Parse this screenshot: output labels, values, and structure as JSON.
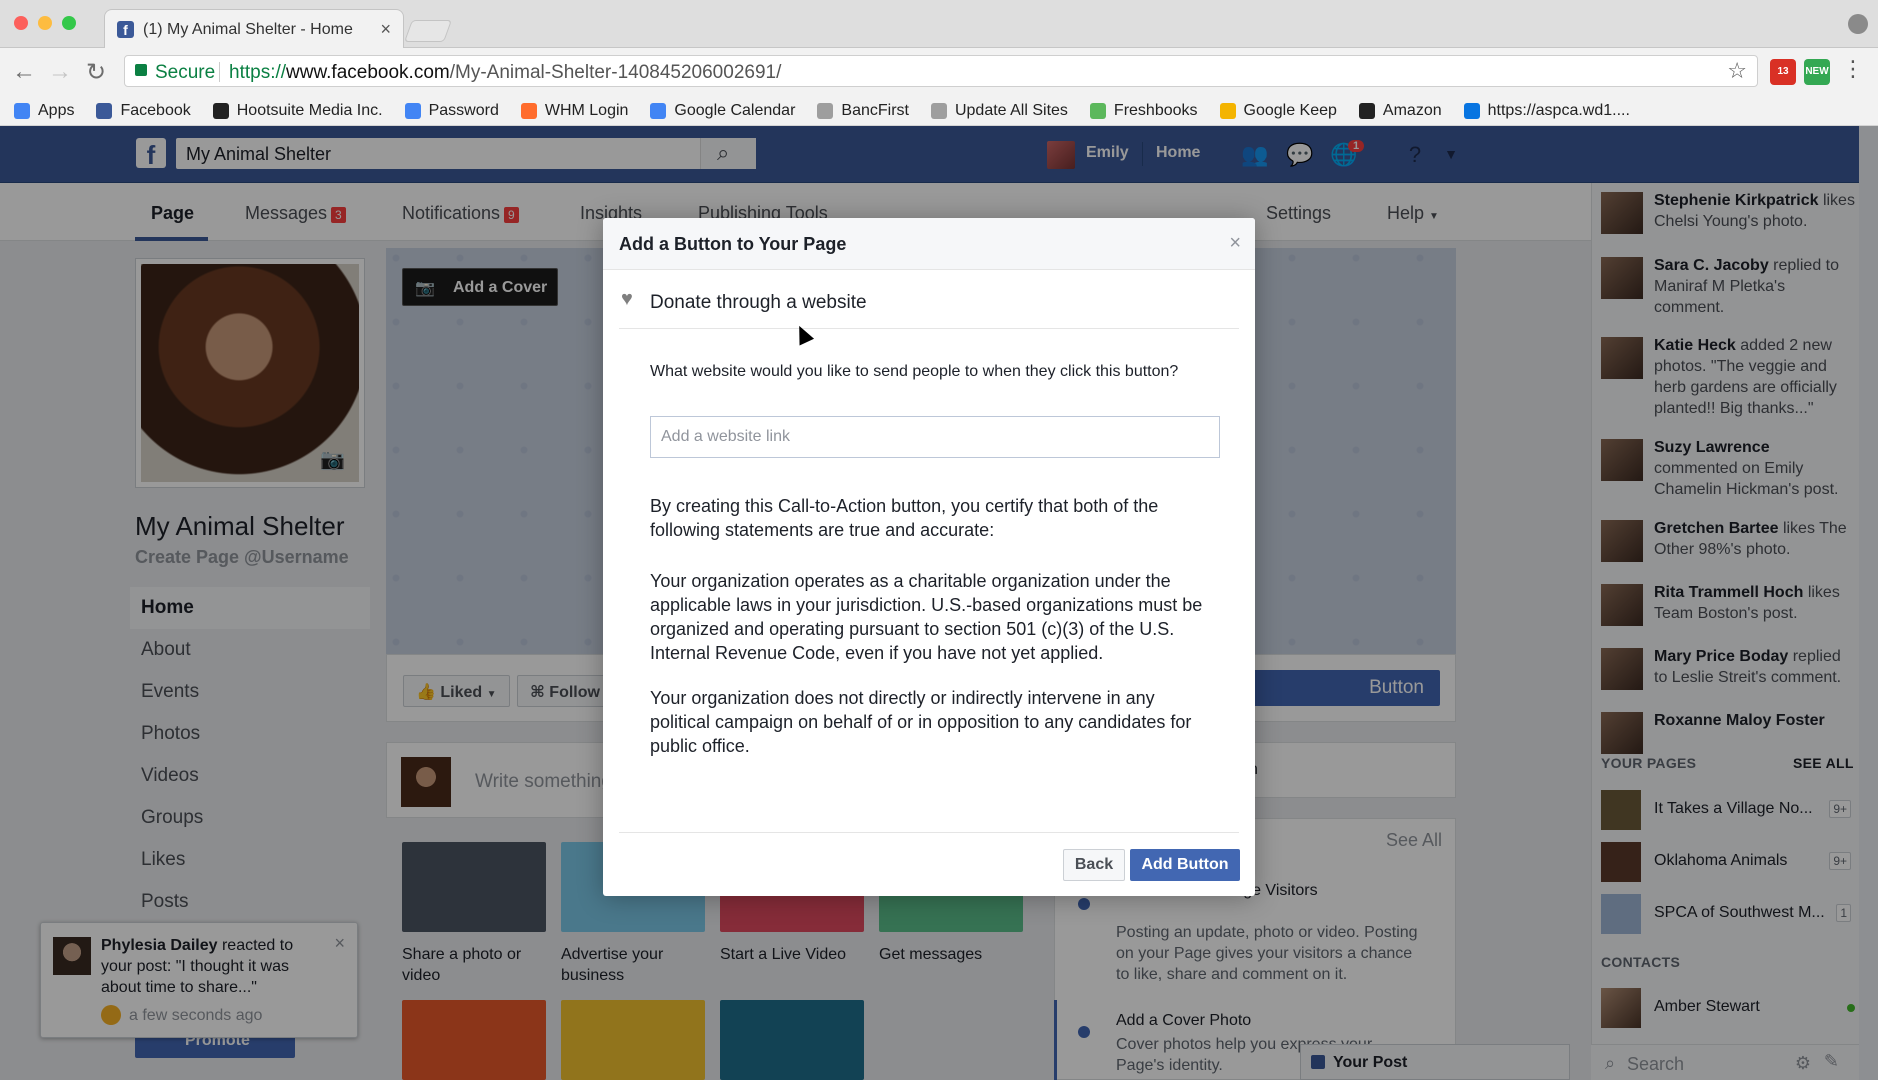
{
  "browser": {
    "tab_title": "(1) My Animal Shelter - Home",
    "secure_label": "Secure",
    "url_scheme": "https://",
    "url_host": "www.facebook.com",
    "url_path": "/My-Animal-Shelter-140845206002691/",
    "extensions": [
      {
        "label": "13",
        "color": "#d93025"
      },
      {
        "label": "NEW",
        "color": "#34a853"
      }
    ],
    "bookmarks": [
      {
        "label": "Apps",
        "icon": "apps-grid-icon",
        "color": "#4285f4"
      },
      {
        "label": "Facebook",
        "icon": "facebook-icon",
        "color": "#3b5998"
      },
      {
        "label": "Hootsuite Media Inc.",
        "icon": "hootsuite-icon",
        "color": "#222222"
      },
      {
        "label": "Password",
        "icon": "google-icon",
        "color": "#4285f4"
      },
      {
        "label": "WHM Login",
        "icon": "cpanel-icon",
        "color": "#ff6c2c"
      },
      {
        "label": "Google Calendar",
        "icon": "google-icon",
        "color": "#4285f4"
      },
      {
        "label": "BancFirst",
        "icon": "page-icon",
        "color": "#9e9e9e"
      },
      {
        "label": "Update All Sites",
        "icon": "page-icon",
        "color": "#9e9e9e"
      },
      {
        "label": "Freshbooks",
        "icon": "leaf-icon",
        "color": "#5cb85c"
      },
      {
        "label": "Google Keep",
        "icon": "keep-icon",
        "color": "#f4b400"
      },
      {
        "label": "Amazon",
        "icon": "amazon-icon",
        "color": "#222222"
      },
      {
        "label": "https://aspca.wd1....",
        "icon": "workday-icon",
        "color": "#0875e1"
      }
    ]
  },
  "fb": {
    "search_value": "My Animal Shelter",
    "user_name": "Emily",
    "home_label": "Home",
    "notif_count": "1"
  },
  "page_tabs": [
    {
      "label": "Page",
      "badge": ""
    },
    {
      "label": "Messages",
      "badge": "3"
    },
    {
      "label": "Notifications",
      "badge": "9"
    },
    {
      "label": "Insights",
      "badge": ""
    },
    {
      "label": "Publishing Tools",
      "badge": ""
    },
    {
      "label": "Settings",
      "badge": ""
    },
    {
      "label": "Help",
      "badge": ""
    }
  ],
  "page": {
    "name": "My Animal Shelter",
    "username_link": "Create Page @Username",
    "nav": [
      "Home",
      "About",
      "Events",
      "Photos",
      "Videos",
      "Groups",
      "Likes",
      "Posts"
    ],
    "add_cover": "Add a Cover",
    "liked": "Liked",
    "follow": "Follow",
    "cta_button": "Button",
    "composer_placeholder": "Write something",
    "tiles": [
      {
        "label": "Share a photo or video",
        "color": "#4b5563"
      },
      {
        "label": "Advertise your business",
        "color": "#7cc8e8"
      },
      {
        "label": "Start a Live Video",
        "color": "#e04a5f"
      },
      {
        "label": "Get messages",
        "color": "#5bbf8a"
      }
    ],
    "tiles_row2": [
      {
        "color": "#e8592a"
      },
      {
        "color": "#f2c230"
      },
      {
        "color": "#1e6f8c"
      }
    ],
    "card_suffix": "n",
    "see_all": "See All",
    "tip1_title": "nect With Your Page Visitors",
    "tip1_body": "Posting an update, photo or video. Posting on your Page gives your visitors a chance to like, share and comment on it.",
    "tip2_title": "Add a Cover Photo",
    "tip2_body": "Cover photos help you express your Page's identity.",
    "your_post": "Your Post",
    "promote": "Promote"
  },
  "toast": {
    "actor": "Phylesia Dailey",
    "text": " reacted to your post: \"I thought it was about time to share...\"",
    "time": "a few seconds ago"
  },
  "ticker": {
    "items": [
      {
        "actor": "Stephenie Kirkpatrick",
        "text": " likes Chelsi Young's photo."
      },
      {
        "actor": "Sara C. Jacoby",
        "text": " replied to Maniraf M Pletka's comment."
      },
      {
        "actor": "Katie Heck",
        "text": " added 2 new photos. \"The veggie and herb gardens are officially planted!! Big thanks...\""
      },
      {
        "actor": "Suzy Lawrence",
        "text": " commented on Emily Chamelin Hickman's post."
      },
      {
        "actor": "Gretchen Bartee",
        "text": " likes The Other 98%'s photo."
      },
      {
        "actor": "Rita Trammell Hoch",
        "text": " likes Team Boston's post."
      },
      {
        "actor": "Mary Price Boday",
        "text": " replied to Leslie Streit's comment."
      },
      {
        "actor": "Roxanne Maloy Foster",
        "text": ""
      }
    ],
    "your_pages_heading": "YOUR PAGES",
    "see_all": "SEE ALL",
    "pages": [
      {
        "name": "It Takes a Village No...",
        "count": "9+"
      },
      {
        "name": "Oklahoma Animals",
        "count": "9+"
      },
      {
        "name": "SPCA of Southwest M...",
        "count": "1"
      }
    ],
    "contacts_heading": "CONTACTS",
    "contacts": [
      {
        "name": "Amber Stewart",
        "status_color": "#42b72a"
      }
    ],
    "search_placeholder": "Search"
  },
  "modal": {
    "title": "Add a Button to Your Page",
    "option": "Donate through a website",
    "question": "What website would you like to send people to when they click this button?",
    "input_placeholder": "Add a website link",
    "para1": "By creating this Call-to-Action button, you certify that both of the following statements are true and accurate:",
    "para2": "Your organization operates as a charitable organization under the applicable laws in your jurisdiction. U.S.-based organizations must be organized and operating pursuant to section 501 (c)(3) of the U.S. Internal Revenue Code, even if you have not yet applied.",
    "para3": "Your organization does not directly or indirectly intervene in any political campaign on behalf of or in opposition to any candidates for public office.",
    "back": "Back",
    "add": "Add Button"
  }
}
